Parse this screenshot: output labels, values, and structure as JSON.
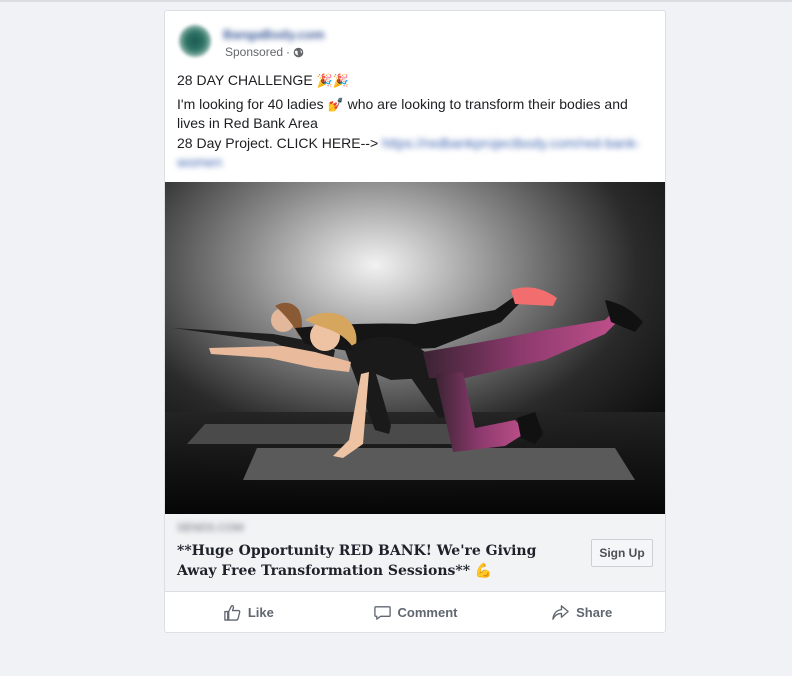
{
  "post": {
    "page_name": "BangaBody.com",
    "sponsored": "Sponsored",
    "separator": "·",
    "icons": {
      "privacy": "globe-icon",
      "celebration": "party-popper-emoji",
      "nails": "nail-polish-emoji",
      "flex": "flexed-biceps-emoji"
    },
    "text": {
      "line1": "28 DAY CHALLENGE",
      "line1_emoji": "🎉🎉",
      "line2a": "I'm looking for 40 ladies",
      "line2_emoji": "💅",
      "line2b": "who are looking to transform their bodies and lives in Red Bank Area",
      "line3": "28 Day Project. CLICK HERE-->",
      "link": "https://redbankprojectbody.com/red-bank-women"
    }
  },
  "link_preview": {
    "domain": "SENDS.COM",
    "headline": "**Huge Opportunity RED BANK! We're Giving Away Free Transformation Sessions**",
    "headline_emoji": "💪",
    "cta": "Sign Up"
  },
  "actions": {
    "like": "Like",
    "comment": "Comment",
    "share": "Share"
  },
  "colors": {
    "background": "#f0f2f5",
    "card": "#ffffff",
    "link": "#4267b2",
    "action_text": "#606770"
  }
}
